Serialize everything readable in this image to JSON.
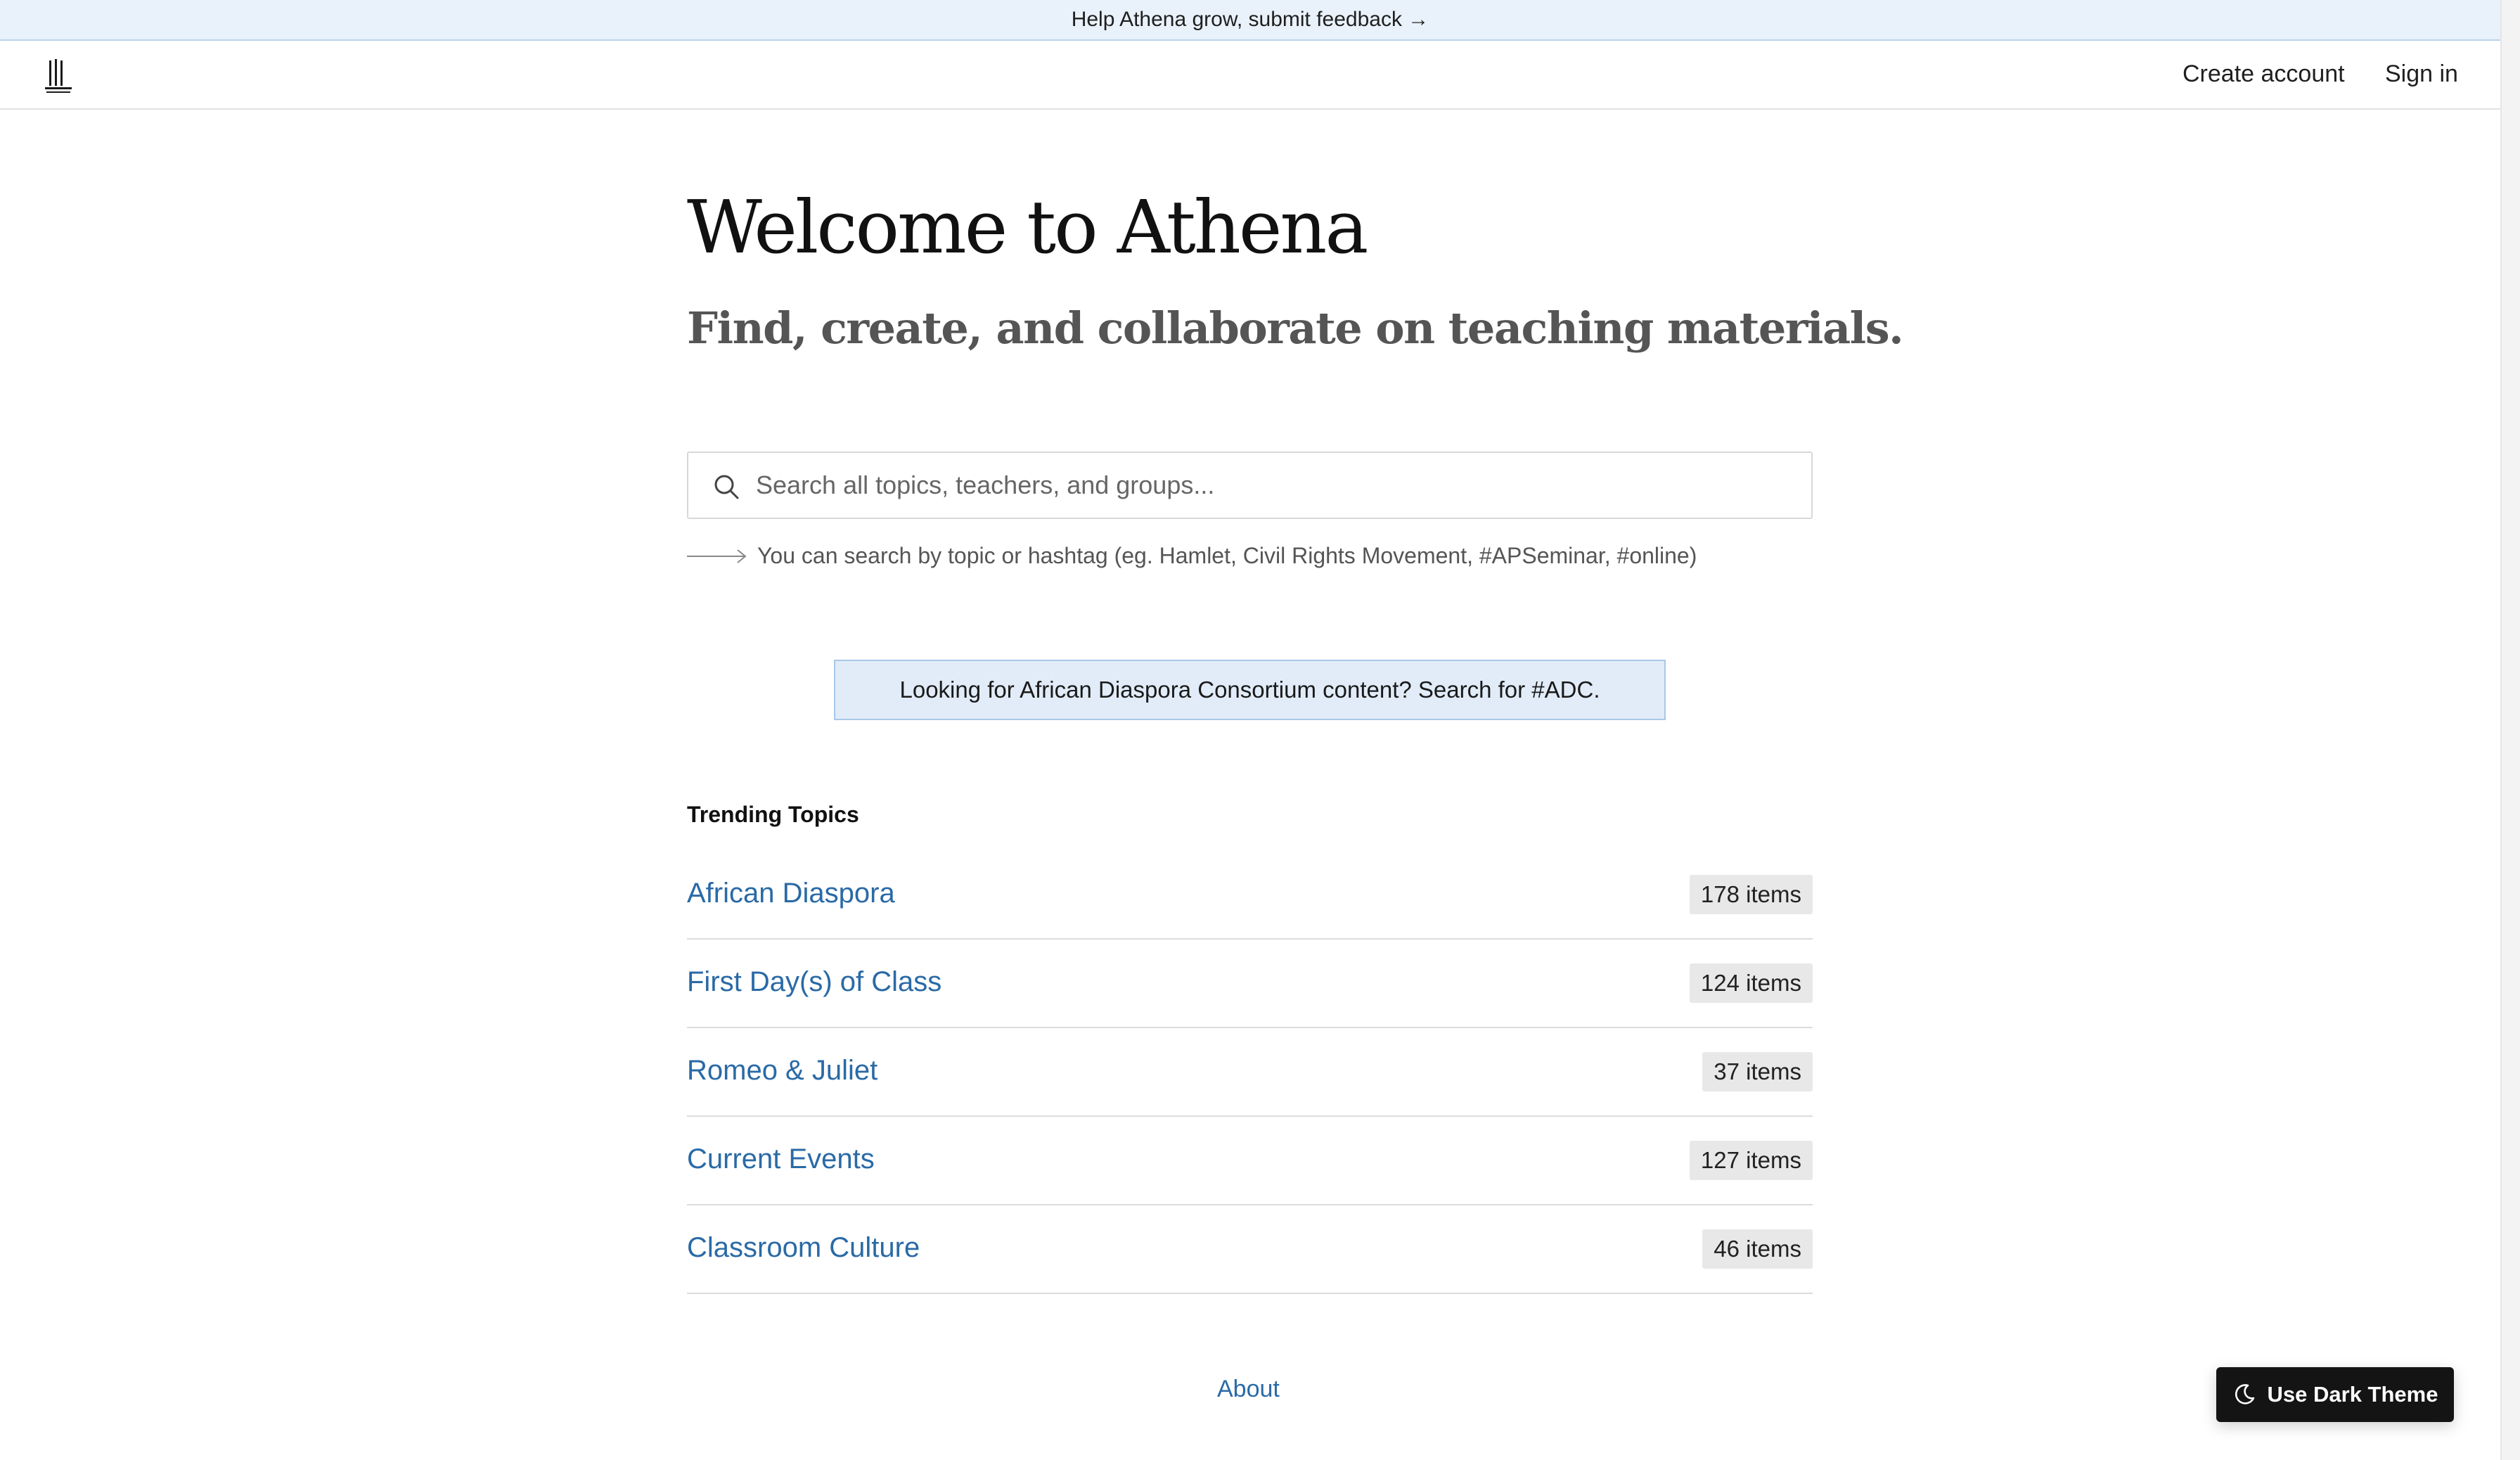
{
  "banner": {
    "text": "Help Athena grow, submit feedback →"
  },
  "header": {
    "logo_icon": "columns-logo-icon",
    "create_account": "Create account",
    "sign_in": "Sign in"
  },
  "hero": {
    "title": "Welcome to Athena",
    "subtitle": "Find, create, and collaborate on teaching materials."
  },
  "search": {
    "icon": "search-icon",
    "placeholder": "Search all topics, teachers, and groups...",
    "value": "",
    "hint_icon": "long-arrow-right-icon",
    "hint": "You can search by topic or hashtag (eg. Hamlet, Civil Rights Movement, #APSeminar, #online)"
  },
  "notice": {
    "text": "Looking for African Diaspora Consortium content? Search for #ADC."
  },
  "trending": {
    "heading": "Trending Topics",
    "topics": [
      {
        "name": "African Diaspora",
        "count": "178 items"
      },
      {
        "name": "First Day(s) of Class",
        "count": "124 items"
      },
      {
        "name": "Romeo & Juliet",
        "count": "37 items"
      },
      {
        "name": "Current Events",
        "count": "127 items"
      },
      {
        "name": "Classroom Culture",
        "count": "46 items"
      }
    ]
  },
  "footer": {
    "about": "About"
  },
  "theme_toggle": {
    "icon": "moon-icon",
    "label": "Use Dark Theme"
  },
  "colors": {
    "link": "#2a6aa6",
    "banner_bg": "#e9f2fa",
    "notice_bg": "#e1ecf8",
    "badge_bg": "#e8e8e8",
    "dark_button": "#141414"
  }
}
